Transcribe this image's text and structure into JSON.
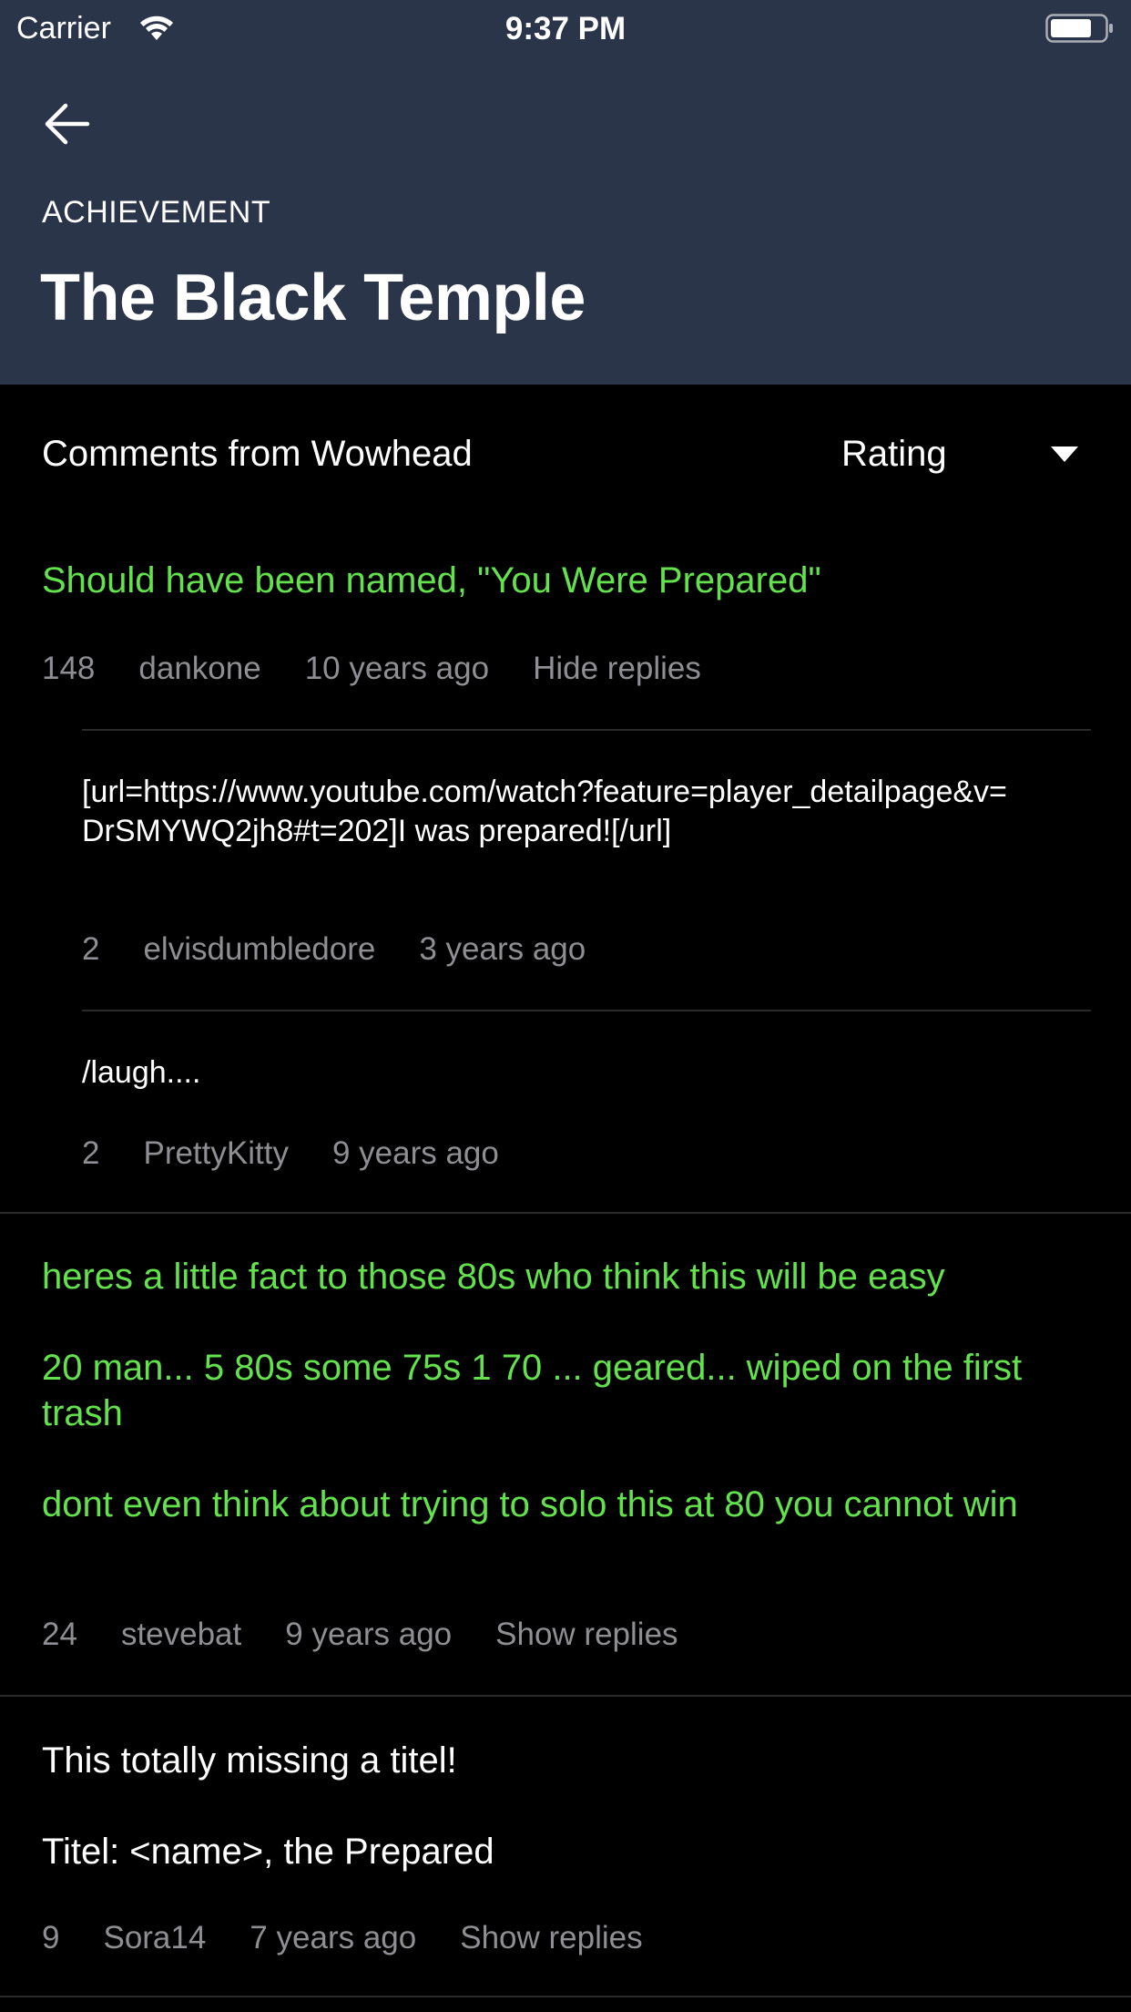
{
  "status": {
    "carrier": "Carrier",
    "time": "9:37 PM"
  },
  "header": {
    "overline": "ACHIEVEMENT",
    "title": "The Black Temple"
  },
  "comments_section": {
    "title": "Comments from Wowhead",
    "sort": {
      "selected": "Rating"
    }
  },
  "comments": [
    {
      "paragraphs": [
        "Should have been named, \"You Were Prepared\""
      ],
      "rating": "148",
      "author": "dankone",
      "time": "10 years ago",
      "action": "Hide replies",
      "replies": [
        {
          "text": "[url=https://www.youtube.com/watch?feature=player_detailpage&v=DrSMYWQ2jh8#t=202]I was prepared![/url]",
          "rating": "2",
          "author": "elvisdumbledore",
          "time": "3 years ago"
        },
        {
          "text": "/laugh....",
          "rating": "2",
          "author": "PrettyKitty",
          "time": "9 years ago"
        }
      ]
    },
    {
      "paragraphs": [
        "heres a little fact to those 80s who think this will be easy",
        "20 man... 5 80s some 75s 1 70 ... geared... wiped on the first trash",
        "dont even think about trying to solo this at 80 you cannot win"
      ],
      "rating": "24",
      "author": "stevebat",
      "time": "9 years ago",
      "action": "Show replies"
    },
    {
      "paragraphs": [
        "This totally missing a titel!",
        "Titel: <name>, the Prepared"
      ],
      "rating": "9",
      "author": "Sora14",
      "time": "7 years ago",
      "action": "Show replies"
    }
  ],
  "colors": {
    "header_bg": "#2b354a",
    "highlight_text": "#64e24e",
    "meta_text": "#8e8e93"
  }
}
